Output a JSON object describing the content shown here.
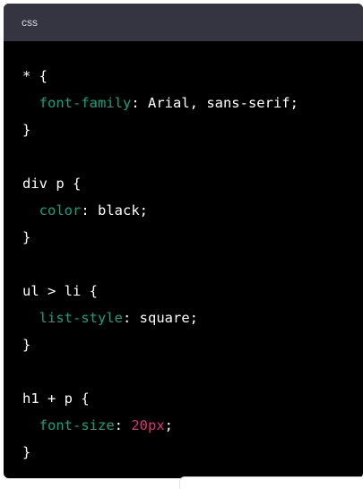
{
  "header": {
    "language": "css"
  },
  "code": {
    "lines": [
      [
        {
          "t": "* {",
          "c": "plain"
        }
      ],
      [
        {
          "t": "  ",
          "c": "plain"
        },
        {
          "t": "font-family",
          "c": "prop"
        },
        {
          "t": ": Arial, sans-serif;",
          "c": "plain"
        }
      ],
      [
        {
          "t": "}",
          "c": "plain"
        }
      ],
      [
        {
          "t": "",
          "c": "plain"
        }
      ],
      [
        {
          "t": "div p {",
          "c": "plain"
        }
      ],
      [
        {
          "t": "  ",
          "c": "plain"
        },
        {
          "t": "color",
          "c": "prop"
        },
        {
          "t": ": black;",
          "c": "plain"
        }
      ],
      [
        {
          "t": "}",
          "c": "plain"
        }
      ],
      [
        {
          "t": "",
          "c": "plain"
        }
      ],
      [
        {
          "t": "ul > li {",
          "c": "plain"
        }
      ],
      [
        {
          "t": "  ",
          "c": "plain"
        },
        {
          "t": "list-style",
          "c": "prop"
        },
        {
          "t": ": square;",
          "c": "plain"
        }
      ],
      [
        {
          "t": "}",
          "c": "plain"
        }
      ],
      [
        {
          "t": "",
          "c": "plain"
        }
      ],
      [
        {
          "t": "h1 + p {",
          "c": "plain"
        }
      ],
      [
        {
          "t": "  ",
          "c": "plain"
        },
        {
          "t": "font-size",
          "c": "prop"
        },
        {
          "t": ": ",
          "c": "plain"
        },
        {
          "t": "20px",
          "c": "num"
        },
        {
          "t": ";",
          "c": "plain"
        }
      ],
      [
        {
          "t": "}",
          "c": "plain"
        }
      ]
    ]
  },
  "colors": {
    "background": "#000000",
    "header_background": "#343541",
    "property": "#10a37f",
    "number": "#df3079",
    "text": "#ffffff"
  }
}
